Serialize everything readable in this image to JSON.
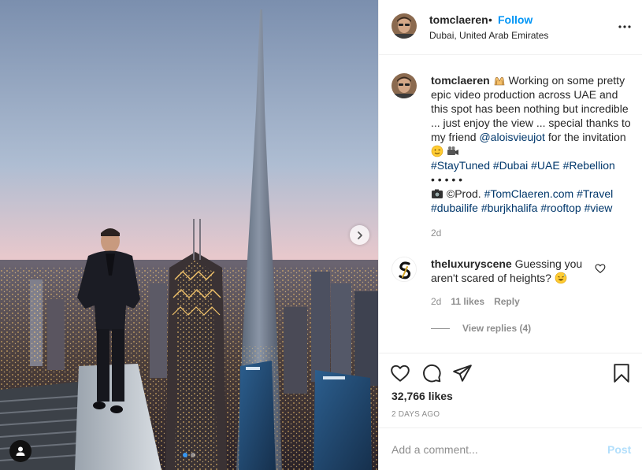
{
  "post": {
    "author": {
      "username": "tomclaeren",
      "separator": "•",
      "follow_label": "Follow",
      "location": "Dubai, United Arab Emirates"
    },
    "caption": {
      "username": "tomclaeren",
      "text_1": "Working on some pretty epic video production across UAE and this spot has been nothing but incredible ... just enjoy the view ... special thanks to my friend",
      "mention": "@aloisvieujot",
      "text_2": "for the invitation",
      "hashtags_1": [
        "#StayTuned",
        "#Dubai",
        "#UAE",
        "#Rebellion"
      ],
      "dots_line": "• • • • •",
      "prod_prefix": "©Prod.",
      "hashtags_2": [
        "#TomClaeren.com",
        "#Travel",
        "#dubailife",
        "#burjkhalifa",
        "#rooftop",
        "#view"
      ],
      "time": "2d"
    },
    "comments": [
      {
        "username": "theluxuryscene",
        "text": "Guessing you aren't scared of heights?",
        "time": "2d",
        "likes": "11 likes",
        "reply_label": "Reply",
        "view_replies": "View replies (4)"
      }
    ],
    "likes_count": "32,766 likes",
    "date": "2 DAYS AGO",
    "comment_input": {
      "placeholder": "Add a comment...",
      "post_label": "Post"
    },
    "carousel": {
      "slide_count": 2,
      "active_index": 0
    },
    "icons": {
      "more": "more-options-icon",
      "like": "heart-icon",
      "comment": "comment-icon",
      "share": "share-icon",
      "save": "bookmark-icon",
      "next": "chevron-right-icon",
      "tags": "user-tag-icon"
    },
    "colors": {
      "link": "#00376b",
      "follow": "#0095f6",
      "muted": "#8e8e8e",
      "post_disabled": "#b2dffc",
      "carousel_active": "#3897f0"
    }
  }
}
